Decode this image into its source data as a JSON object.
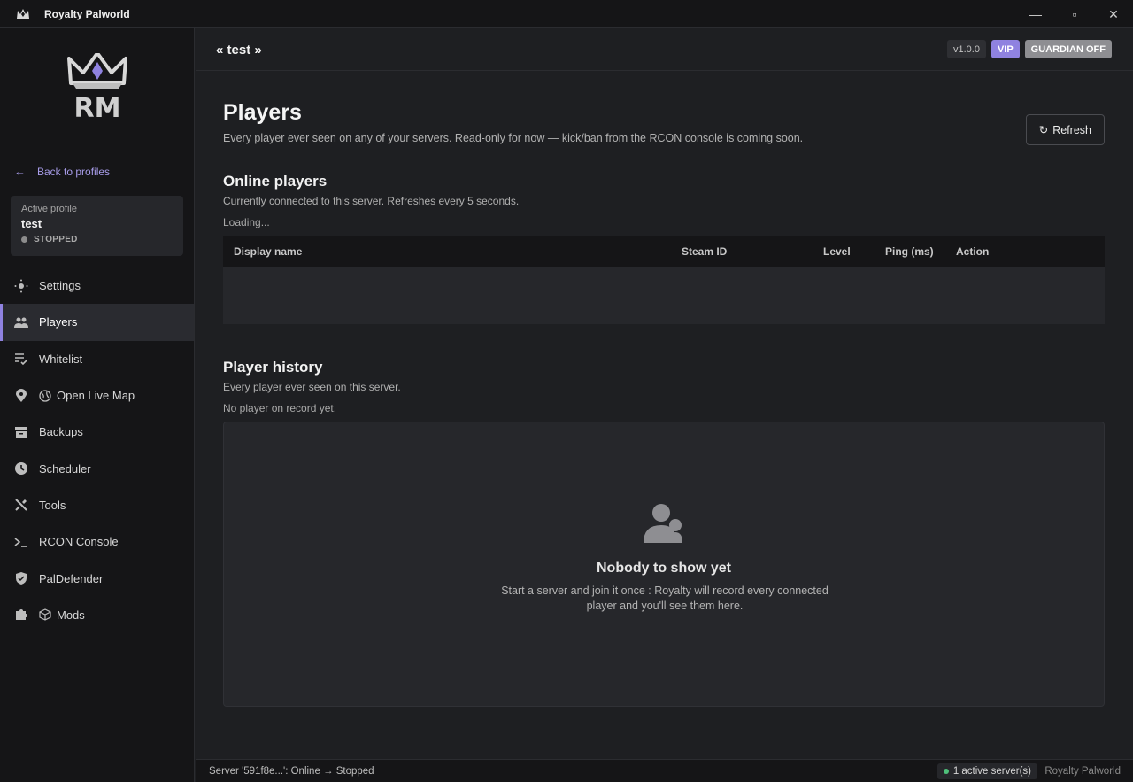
{
  "window": {
    "title": "Royalty Palworld",
    "controls": {
      "minimize": "—",
      "maximize": "▫",
      "close": "✕"
    }
  },
  "sidebar": {
    "logo_text": "RM",
    "back_label": "Back to profiles",
    "profile": {
      "label": "Active profile",
      "name": "test",
      "status": "STOPPED"
    },
    "items": [
      {
        "label": "Settings",
        "icon": "settings-icon"
      },
      {
        "label": "Players",
        "icon": "players-icon",
        "active": true
      },
      {
        "label": "Whitelist",
        "icon": "whitelist-icon"
      },
      {
        "label": "Open Live Map",
        "icon": "map-pin-icon",
        "sub_icon": "globe-icon"
      },
      {
        "label": "Backups",
        "icon": "archive-icon"
      },
      {
        "label": "Scheduler",
        "icon": "clock-icon"
      },
      {
        "label": "Tools",
        "icon": "tools-icon"
      },
      {
        "label": "RCON Console",
        "icon": "terminal-icon"
      },
      {
        "label": "PalDefender",
        "icon": "shield-icon"
      },
      {
        "label": "Mods",
        "icon": "puzzle-icon",
        "sub_icon": "cube-icon"
      }
    ]
  },
  "header": {
    "profile_title": "« test »",
    "version": "v1.0.0",
    "vip": "VIP",
    "guardian": "GUARDIAN OFF"
  },
  "main": {
    "title": "Players",
    "subtitle": "Every player ever seen on any of your servers. Read-only for now — kick/ban from the RCON console is coming soon.",
    "refresh_label": "Refresh",
    "refresh_glyph": "↻",
    "online": {
      "title": "Online players",
      "subtitle": "Currently connected to this server. Refreshes every 5 seconds.",
      "loading": "Loading...",
      "columns": [
        "Display name",
        "Steam ID",
        "Level",
        "Ping (ms)",
        "Action"
      ]
    },
    "history": {
      "title": "Player history",
      "subtitle": "Every player ever seen on this server.",
      "empty_note": "No player on record yet.",
      "empty_title": "Nobody to show yet",
      "empty_text": "Start a server and join it once : Royalty will record every connected player and you'll see them here."
    }
  },
  "statusbar": {
    "message": "Server '591f8e...': Online → Stopped",
    "active_servers": "1 active server(s)",
    "brand": "Royalty Palworld"
  },
  "colors": {
    "accent": "#8f82e0",
    "online_dot": "#4ec07a",
    "background": "#1e1f22",
    "sidebar": "#151517"
  }
}
